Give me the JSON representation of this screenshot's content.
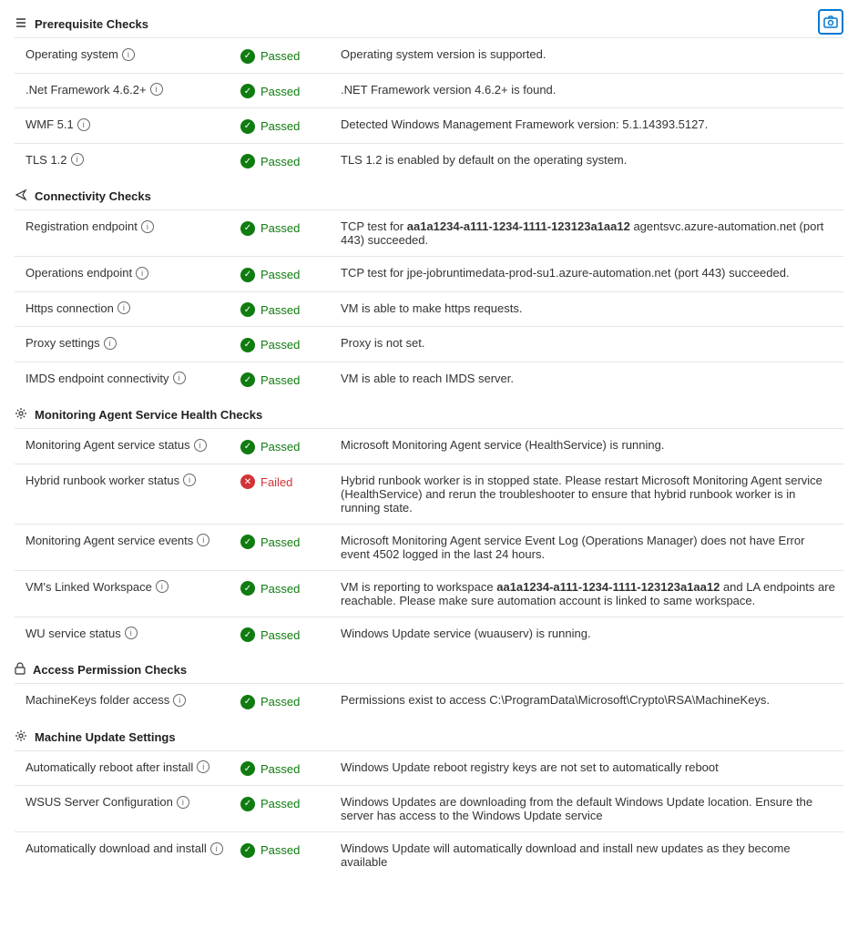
{
  "sections": [
    {
      "id": "prerequisite-checks",
      "icon": "≡",
      "icon_type": "list",
      "title": "Prerequisite Checks",
      "rows": [
        {
          "name": "Operating system",
          "has_info": true,
          "status": "Passed",
          "status_type": "passed",
          "description": "Operating system version is supported."
        },
        {
          "name": ".Net Framework 4.6.2+",
          "has_info": true,
          "status": "Passed",
          "status_type": "passed",
          "description": ".NET Framework version 4.6.2+ is found."
        },
        {
          "name": "WMF 5.1",
          "has_info": true,
          "status": "Passed",
          "status_type": "passed",
          "description": "Detected Windows Management Framework version: 5.1.14393.5127."
        },
        {
          "name": "TLS 1.2",
          "has_info": true,
          "status": "Passed",
          "status_type": "passed",
          "description": "TLS 1.2 is enabled by default on the operating system."
        }
      ]
    },
    {
      "id": "connectivity-checks",
      "icon": "✈",
      "icon_type": "plane",
      "title": "Connectivity Checks",
      "rows": [
        {
          "name": "Registration endpoint",
          "has_info": true,
          "status": "Passed",
          "status_type": "passed",
          "description": "TCP test for aa1a1234-a111-1234-1111-123123a1aa12 agentsvc.azure-automation.net (port 443) succeeded.",
          "highlight": "aa1a1234-a111-1234-1111-123123a1aa12"
        },
        {
          "name": "Operations endpoint",
          "has_info": true,
          "status": "Passed",
          "status_type": "passed",
          "description": "TCP test for jpe-jobruntimedata-prod-su1.azure-automation.net (port 443) succeeded."
        },
        {
          "name": "Https connection",
          "has_info": true,
          "status": "Passed",
          "status_type": "passed",
          "description": "VM is able to make https requests."
        },
        {
          "name": "Proxy settings",
          "has_info": true,
          "status": "Passed",
          "status_type": "passed",
          "description": "Proxy is not set."
        },
        {
          "name": "IMDS endpoint connectivity",
          "has_info": true,
          "status": "Passed",
          "status_type": "passed",
          "description": "VM is able to reach IMDS server."
        }
      ]
    },
    {
      "id": "monitoring-agent-checks",
      "icon": "⚙",
      "icon_type": "gear",
      "title": "Monitoring Agent Service Health Checks",
      "rows": [
        {
          "name": "Monitoring Agent service status",
          "has_info": true,
          "status": "Passed",
          "status_type": "passed",
          "description": "Microsoft Monitoring Agent service (HealthService) is running."
        },
        {
          "name": "Hybrid runbook worker status",
          "has_info": true,
          "status": "Failed",
          "status_type": "failed",
          "description": "Hybrid runbook worker is in stopped state. Please restart Microsoft Monitoring Agent service (HealthService) and rerun the troubleshooter to ensure that hybrid runbook worker is in running state."
        },
        {
          "name": "Monitoring Agent service events",
          "has_info": true,
          "status": "Passed",
          "status_type": "passed",
          "description": "Microsoft Monitoring Agent service Event Log (Operations Manager) does not have Error event 4502 logged in the last 24 hours."
        },
        {
          "name": "VM's Linked Workspace",
          "has_info": true,
          "status": "Passed",
          "status_type": "passed",
          "description": "VM is reporting to workspace aa1a1234-a111-1234-1111-123123a1aa12 and LA endpoints are reachable. Please make sure automation account is linked to same workspace.",
          "highlight": "aa1a1234-a111-1234-1111-123123a1aa12"
        },
        {
          "name": "WU service status",
          "has_info": true,
          "status": "Passed",
          "status_type": "passed",
          "description": "Windows Update service (wuauserv) is running."
        }
      ]
    },
    {
      "id": "access-permission-checks",
      "icon": "🔒",
      "icon_type": "lock",
      "title": "Access Permission Checks",
      "rows": [
        {
          "name": "MachineKeys folder access",
          "has_info": true,
          "status": "Passed",
          "status_type": "passed",
          "description": "Permissions exist to access C:\\ProgramData\\Microsoft\\Crypto\\RSA\\MachineKeys."
        }
      ]
    },
    {
      "id": "machine-update-settings",
      "icon": "⚙",
      "icon_type": "gear2",
      "title": "Machine Update Settings",
      "rows": [
        {
          "name": "Automatically reboot after install",
          "has_info": true,
          "status": "Passed",
          "status_type": "passed",
          "description": "Windows Update reboot registry keys are not set to automatically reboot"
        },
        {
          "name": "WSUS Server Configuration",
          "has_info": true,
          "status": "Passed",
          "status_type": "passed",
          "description": "Windows Updates are downloading from the default Windows Update location. Ensure the server has access to the Windows Update service"
        },
        {
          "name": "Automatically download and install",
          "has_info": true,
          "status": "Passed",
          "status_type": "passed",
          "description": "Windows Update will automatically download and install new updates as they become available"
        }
      ]
    }
  ],
  "labels": {
    "info_tooltip": "i",
    "passed": "Passed",
    "failed": "Failed",
    "check_mark": "✓",
    "x_mark": "✕"
  }
}
